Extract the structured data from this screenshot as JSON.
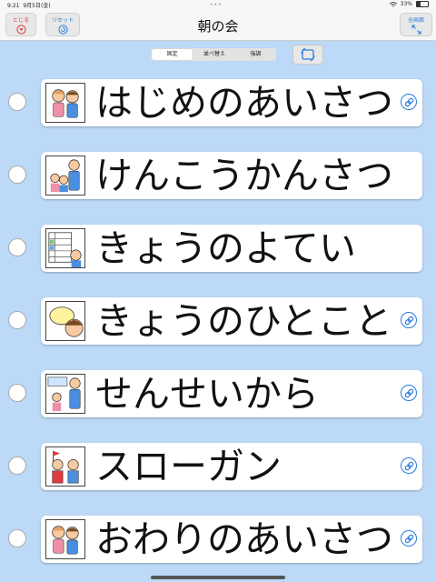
{
  "status": {
    "time": "9:21",
    "date": "9月5日(金)",
    "battery": "33%"
  },
  "nav": {
    "close_label": "とじる",
    "reset_label": "リセット",
    "title": "朝の会",
    "fullscreen_label": "全画面"
  },
  "segments": [
    "固定",
    "並べ替え",
    "強調"
  ],
  "selected_segment": "固定",
  "items": [
    {
      "label": "はじめのあいさつ",
      "pic": "greeting-children-icon",
      "link": true
    },
    {
      "label": "けんこうかんさつ",
      "pic": "health-check-icon",
      "link": false
    },
    {
      "label": "きょうのよてい",
      "pic": "schedule-board-icon",
      "link": false
    },
    {
      "label": "きょうのひとこと",
      "pic": "speech-bubble-icon",
      "link": true
    },
    {
      "label": "せんせいから",
      "pic": "teacher-icon",
      "link": true
    },
    {
      "label": "スローガン",
      "pic": "cheering-children-icon",
      "link": true
    },
    {
      "label": "おわりのあいさつ",
      "pic": "greeting-children-icon",
      "link": true
    }
  ],
  "colors": {
    "background": "#bcd9f7",
    "accent": "#2a7be0",
    "close_red": "#e0393e"
  }
}
